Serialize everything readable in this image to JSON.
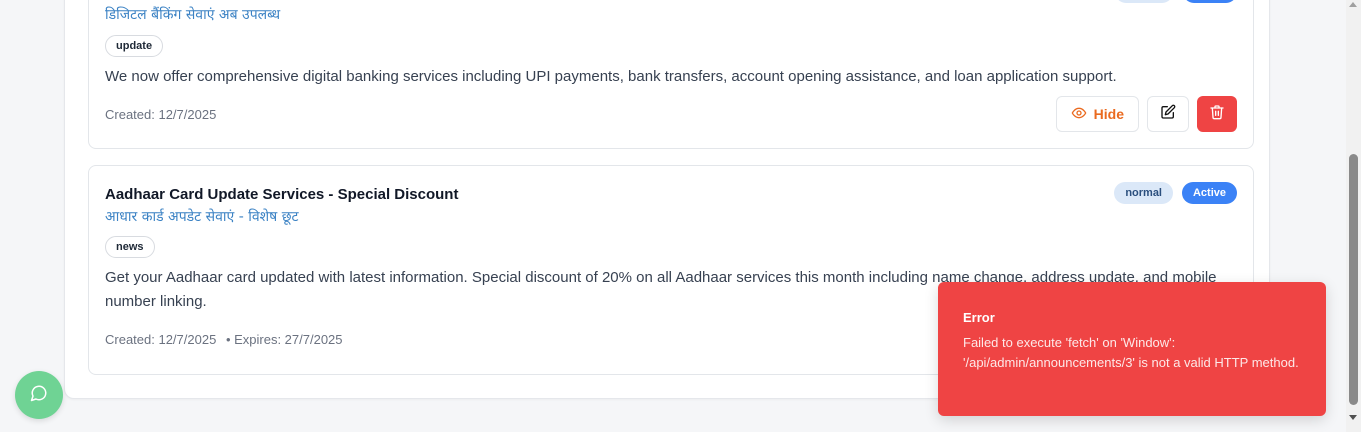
{
  "announcements": [
    {
      "subtitle": "डिजिटल बैंकिंग सेवाएं अब उपलब्ध",
      "tag": "update",
      "body": "We now offer comprehensive digital banking services including UPI payments, bank transfers, account opening assistance, and loan application support.",
      "created": "Created: 12/7/2025",
      "hide_label": "Hide"
    },
    {
      "title": "Aadhaar Card Update Services - Special Discount",
      "subtitle": "आधार कार्ड अपडेट सेवाएं - विशेष छूट",
      "tag": "news",
      "priority": "normal",
      "status": "Active",
      "body": "Get your Aadhaar card updated with latest information. Special discount of 20% on all Aadhaar services this month including name change, address update, and mobile number linking.",
      "created": "Created: 12/7/2025",
      "expires": "• Expires: 27/7/2025"
    }
  ],
  "toast": {
    "title": "Error",
    "message": "Failed to execute 'fetch' on 'Window': '/api/admin/announcements/3' is not a valid HTTP method."
  },
  "colors": {
    "accent": "#3b82f6",
    "danger": "#ef4444",
    "hide": "#ea6a1f",
    "chat": "#6fd394"
  },
  "icons": [
    "eye-icon",
    "edit-icon",
    "trash-icon",
    "chat-icon"
  ]
}
